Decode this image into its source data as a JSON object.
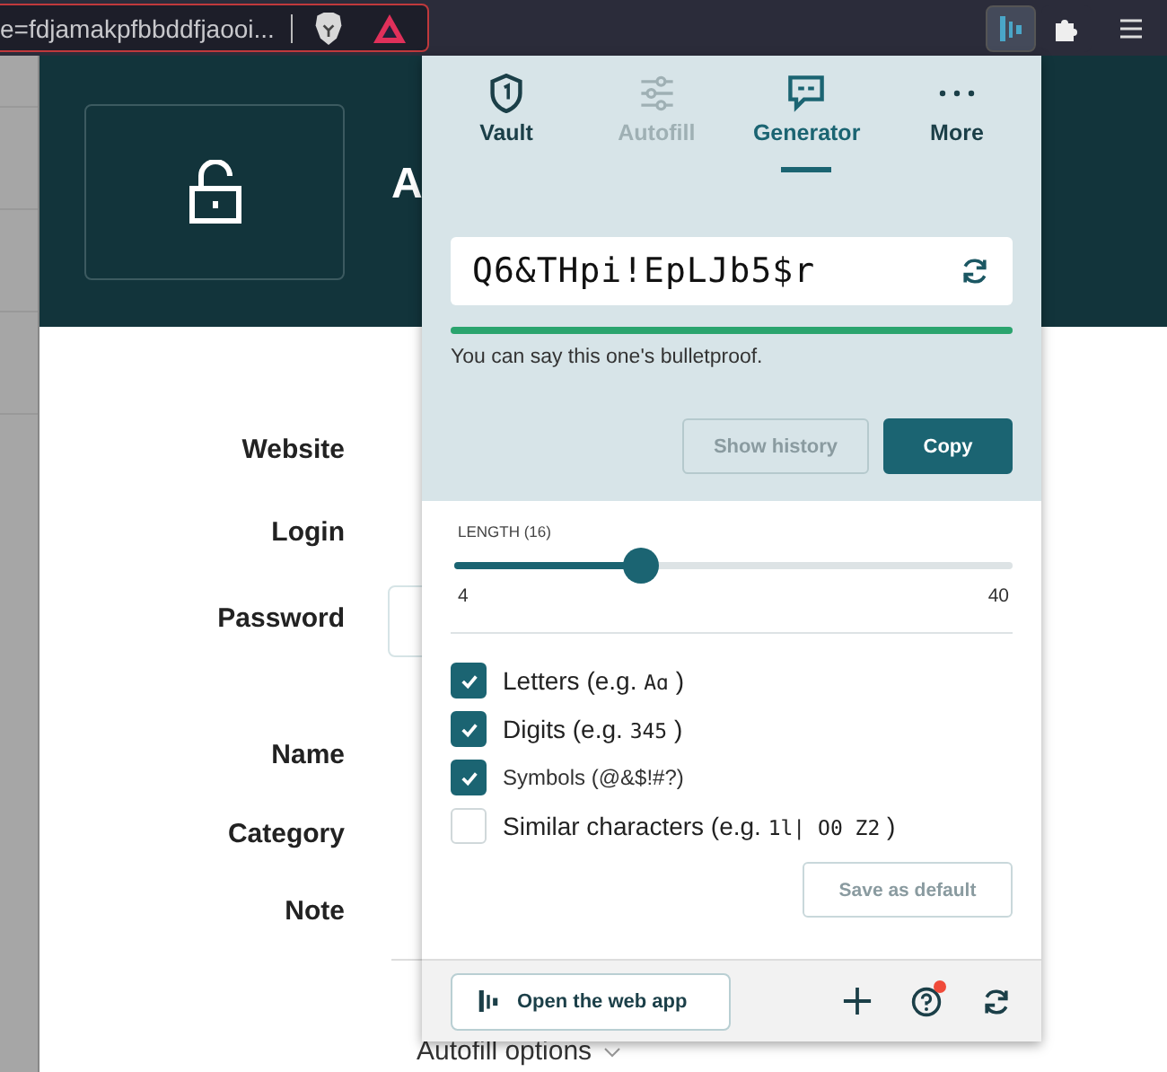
{
  "browser": {
    "address": "e=fdjamakpfbbddfjaooi...",
    "extension_active": true
  },
  "page": {
    "heading": "A",
    "fields": [
      {
        "label": "Website"
      },
      {
        "label": "Login"
      },
      {
        "label": "Password"
      },
      {
        "label": "Name"
      },
      {
        "label": "Category"
      },
      {
        "label": "Note"
      }
    ],
    "autofill_link": "Autofill options"
  },
  "popup": {
    "tabs": [
      {
        "label": "Vault",
        "selected": false,
        "disabled": false
      },
      {
        "label": "Autofill",
        "selected": false,
        "disabled": true
      },
      {
        "label": "Generator",
        "selected": true,
        "disabled": false
      },
      {
        "label": "More",
        "selected": false,
        "disabled": false
      }
    ],
    "password": "Q6&THpi!EpLJb5$r",
    "strength": {
      "level": 1,
      "message": "You can say this one's bulletproof."
    },
    "actions": [
      {
        "label": "Show history",
        "kind": "secondary"
      },
      {
        "label": "Copy",
        "kind": "primary"
      }
    ],
    "length": {
      "label": "LENGTH (16)",
      "level": 0.333,
      "min": "4",
      "max": "40"
    },
    "options": [
      {
        "kind": "sample",
        "text": "Letters (e.g.",
        "sample": "Aɑ",
        "close": ")",
        "checked": true
      },
      {
        "kind": "sample",
        "text": "Digits (e.g.",
        "sample": "345",
        "close": ")",
        "checked": true
      },
      {
        "kind": "plain",
        "text": "Symbols (@&$!#?)",
        "checked": true
      },
      {
        "kind": "sample",
        "text": "Similar characters (e.g.",
        "sample": "1l|  O0 Z2",
        "close": ")",
        "checked": false
      }
    ],
    "save_default": "Save as default",
    "web_app": "Open the web app",
    "help_notification": true
  }
}
